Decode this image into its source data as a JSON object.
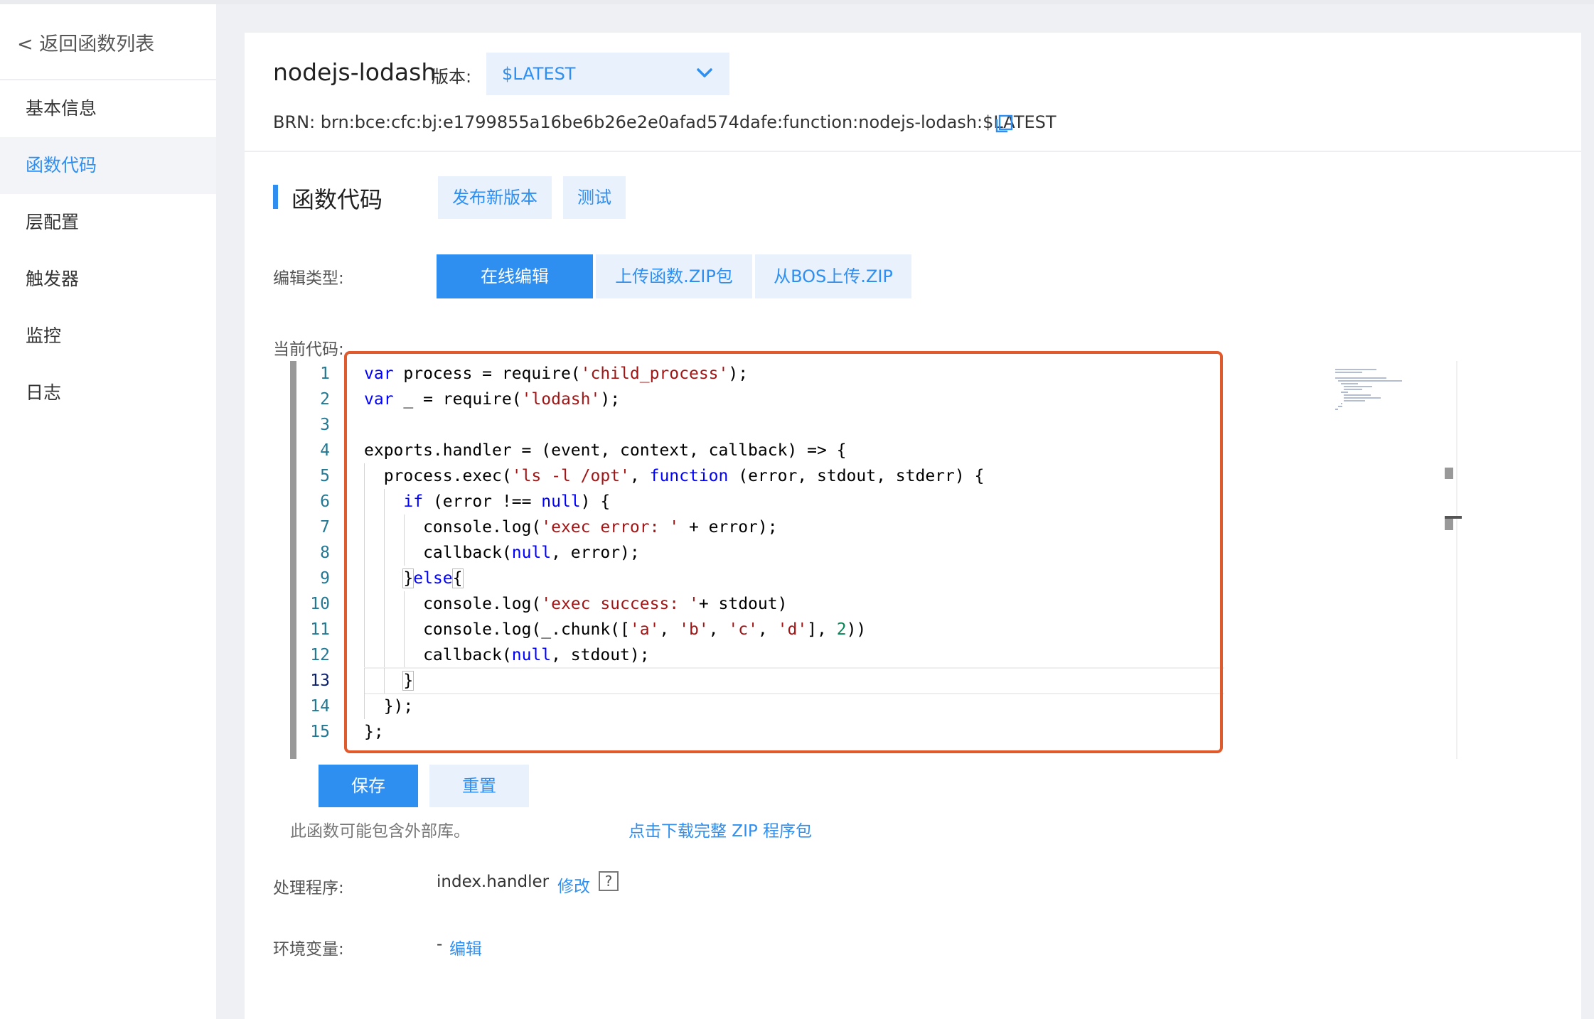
{
  "sidebar": {
    "back": "< 返回函数列表",
    "items": [
      {
        "label": "基本信息",
        "active": false
      },
      {
        "label": "函数代码",
        "active": true
      },
      {
        "label": "层配置",
        "active": false
      },
      {
        "label": "触发器",
        "active": false
      },
      {
        "label": "监控",
        "active": false
      },
      {
        "label": "日志",
        "active": false
      }
    ]
  },
  "header": {
    "function_name": "nodejs-lodash",
    "version_label": "版本:",
    "version_value": "$LATEST",
    "brn": "BRN:  brn:bce:cfc:bj:e1799855a16be6b26e2e0afad574dafe:function:nodejs-lodash:$LATEST"
  },
  "section": {
    "title": "函数代码",
    "publish_button": "发布新版本",
    "test_button": "测试"
  },
  "edit_type": {
    "label": "编辑类型:",
    "options": [
      "在线编辑",
      "上传函数.ZIP包",
      "从BOS上传.ZIP"
    ],
    "selected": "在线编辑"
  },
  "code": {
    "label": "当前代码:",
    "current_line": 13,
    "lines": [
      "var process = require('child_process');",
      "var _ = require('lodash');",
      "",
      "exports.handler = (event, context, callback) => {",
      "  process.exec('ls -l /opt', function (error, stdout, stderr) {",
      "    if (error !== null) {",
      "      console.log('exec error: ' + error);",
      "      callback(null, error);",
      "    }else{",
      "      console.log('exec success: '+ stdout)",
      "      console.log(_.chunk(['a', 'b', 'c', 'd'], 2))",
      "      callback(null, stdout);",
      "    }",
      "  });",
      "};"
    ]
  },
  "actions": {
    "save": "保存",
    "reset": "重置"
  },
  "note": "此函数可能包含外部库。",
  "download_link": "点击下载完整 ZIP 程序包",
  "handler": {
    "label": "处理程序:",
    "value": "index.handler",
    "edit_link": "修改",
    "help": "?"
  },
  "env": {
    "label": "环境变量:",
    "value": "-",
    "edit_link": "编辑"
  },
  "colors": {
    "accent": "#2f8ff0",
    "highlight_border": "#e05a2b",
    "keyword": "#0000ff",
    "string": "#a31515",
    "number": "#098658"
  }
}
